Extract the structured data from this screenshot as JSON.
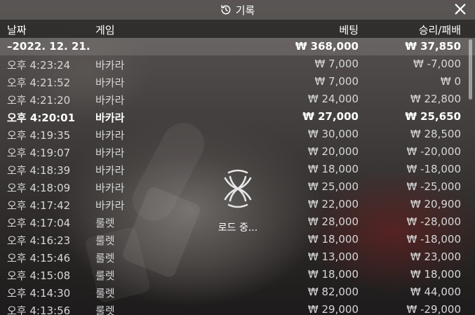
{
  "header": {
    "title": "기록"
  },
  "columns": {
    "date": "날짜",
    "game": "게임",
    "bet": "베팅",
    "win": "승리/패배"
  },
  "summary": {
    "date": "–2022. 12. 21.",
    "bet": "₩ 368,000",
    "win": "₩ 37,850"
  },
  "rows": [
    {
      "date": "오후 4:23:24",
      "game": "바카라",
      "bet": "₩ 7,000",
      "win": "₩ -7,000"
    },
    {
      "date": "오후 4:21:52",
      "game": "바카라",
      "bet": "₩ 7,000",
      "win": "₩ 0"
    },
    {
      "date": "오후 4:21:20",
      "game": "바카라",
      "bet": "₩ 24,000",
      "win": "₩ 22,800"
    },
    {
      "date": "오후 4:20:01",
      "game": "바카라",
      "bet": "₩ 27,000",
      "win": "₩ 25,650"
    },
    {
      "date": "오후 4:19:35",
      "game": "바카라",
      "bet": "₩ 30,000",
      "win": "₩ 28,500"
    },
    {
      "date": "오후 4:19:07",
      "game": "바카라",
      "bet": "₩ 20,000",
      "win": "₩ -20,000"
    },
    {
      "date": "오후 4:18:39",
      "game": "바카라",
      "bet": "₩ 18,000",
      "win": "₩ -18,000"
    },
    {
      "date": "오후 4:18:09",
      "game": "바카라",
      "bet": "₩ 25,000",
      "win": "₩ -25,000"
    },
    {
      "date": "오후 4:17:42",
      "game": "바카라",
      "bet": "₩ 22,000",
      "win": "₩ 20,900"
    },
    {
      "date": "오후 4:17:04",
      "game": "룰렛",
      "bet": "₩ 28,000",
      "win": "₩ -28,000"
    },
    {
      "date": "오후 4:16:23",
      "game": "룰렛",
      "bet": "₩ 18,000",
      "win": "₩ -18,000"
    },
    {
      "date": "오후 4:15:46",
      "game": "룰렛",
      "bet": "₩ 13,000",
      "win": "₩ 23,000"
    },
    {
      "date": "오후 4:15:08",
      "game": "룰렛",
      "bet": "₩ 18,000",
      "win": "₩ 18,000"
    },
    {
      "date": "오후 4:14:30",
      "game": "룰렛",
      "bet": "₩ 82,000",
      "win": "₩ 44,000"
    },
    {
      "date": "오후 4:13:56",
      "game": "룰렛",
      "bet": "₩ 29,000",
      "win": "₩ -29,000"
    }
  ],
  "loader": {
    "text": "로드 중..."
  },
  "icons": {
    "title_icon": "history-icon",
    "close": "close-icon",
    "spinner": "loading-spinner-icon"
  },
  "colors": {
    "text": "#ffffff",
    "muted_text": "#d7d7d7",
    "header_bar": "#141414"
  }
}
